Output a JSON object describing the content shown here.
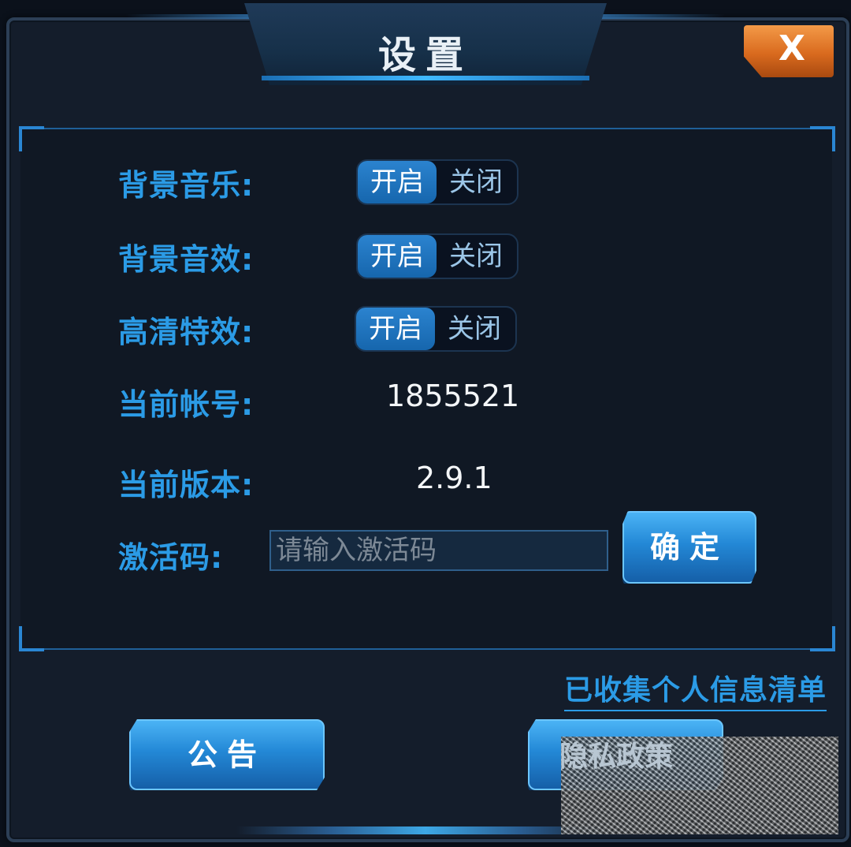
{
  "dialog": {
    "title": "设置",
    "close_label": "X"
  },
  "settings": {
    "bg_music": {
      "label": "背景音乐:",
      "on": "开启",
      "off": "关闭",
      "state": "on"
    },
    "bg_sfx": {
      "label": "背景音效:",
      "on": "开启",
      "off": "关闭",
      "state": "on"
    },
    "hd_effects": {
      "label": "高清特效:",
      "on": "开启",
      "off": "关闭",
      "state": "on"
    },
    "account": {
      "label": "当前帐号:",
      "value": "1855521"
    },
    "version": {
      "label": "当前版本:",
      "value": "2.9.1"
    },
    "activation": {
      "label": "激活码:",
      "placeholder": "请输入激活码",
      "value": "",
      "confirm_label": "确定"
    }
  },
  "footer": {
    "info_link": "已收集个人信息清单",
    "notice_label": "公告",
    "privacy_label": "隐私政策"
  },
  "colors": {
    "label_blue": "#2b9be6",
    "toggle_active": "#1f74bf",
    "close_orange": "#e07a2a"
  }
}
